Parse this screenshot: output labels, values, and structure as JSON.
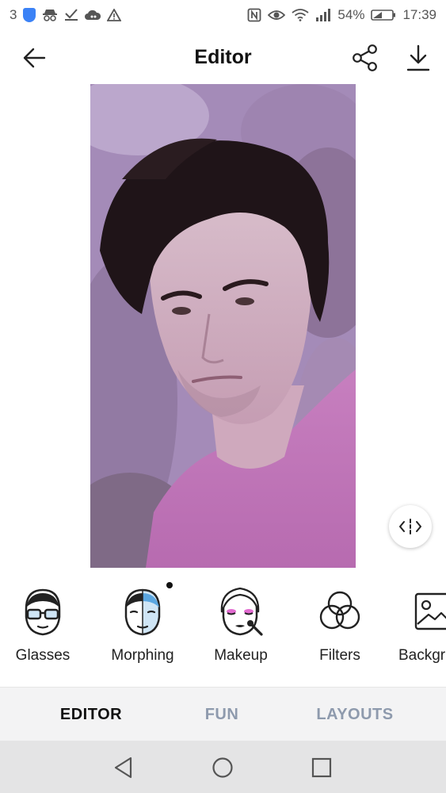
{
  "status_bar": {
    "left_count": "3",
    "battery": "54%",
    "time": "17:39",
    "icons_left": [
      "shield-icon",
      "incognito-icon",
      "check-download-icon",
      "cloud-game-icon",
      "warning-icon"
    ],
    "icons_right": [
      "nfc-icon",
      "eye-icon",
      "wifi-icon",
      "signal-icon",
      "battery-icon"
    ]
  },
  "app_bar": {
    "title": "Editor",
    "icons": [
      "arrow-back-icon",
      "share-icon",
      "download-icon"
    ]
  },
  "tools": [
    {
      "label": "Glasses",
      "icon": "glasses-face-icon"
    },
    {
      "label": "Morphing",
      "icon": "morphing-face-icon",
      "has_dot": true
    },
    {
      "label": "Makeup",
      "icon": "makeup-face-icon"
    },
    {
      "label": "Filters",
      "icon": "filters-icon"
    },
    {
      "label": "Backgr",
      "icon": "background-image-icon"
    }
  ],
  "bottom_tabs": [
    {
      "label": "EDITOR",
      "active": true
    },
    {
      "label": "FUN",
      "active": false
    },
    {
      "label": "LAYOUTS",
      "active": false
    }
  ],
  "colors": {
    "accent_blue": "#5aa6e0",
    "makeup_pink": "#e26bd0",
    "tab_inactive": "#8e9aad",
    "shield_blue": "#3b82f6"
  }
}
